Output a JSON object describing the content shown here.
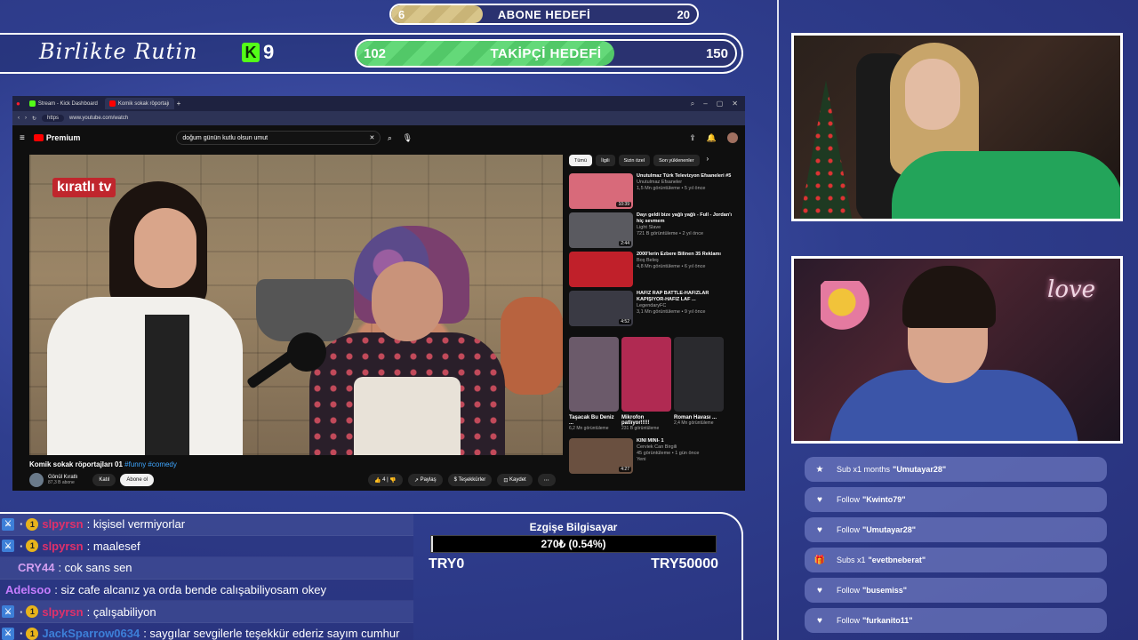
{
  "sub_goal": {
    "min": "6",
    "title": "ABONE HEDEFİ",
    "max": "20",
    "progress": 0.3
  },
  "follow_goal": {
    "min": "102",
    "title": "TAKİPÇİ HEDEFİ",
    "max": "150",
    "progress": 0.68
  },
  "stream": {
    "title": "Birlikte Rutin",
    "kick_badge": "K",
    "viewer_count": "9"
  },
  "browser": {
    "tabs": [
      {
        "label": "Stream - Kick Dashboard",
        "color": "#53fc18"
      },
      {
        "label": "Komik sokak röportajı",
        "color": "#ff0000"
      }
    ],
    "url": "www.youtube.com/watch",
    "https_tag": "https"
  },
  "youtube": {
    "logo": "Premium",
    "search_query": "doğum günün kutlu olsun umut",
    "brand_overlay": "kıratlı tv",
    "video_title": "Komik sokak röportajları 01",
    "video_tags": "#funny #comedy",
    "channel_name": "Gönül Kıratlı",
    "channel_subs": "87,3 B abone",
    "join_label": "Katıl",
    "subscribe_label": "Abone ol",
    "like_count": "4",
    "share_label": "Paylaş",
    "thanks_label": "Teşekkürler",
    "save_label": "Kaydet",
    "chips": [
      "Tümü",
      "İlgili",
      "Sizin özel",
      "Son yüklenenler"
    ],
    "recommendations": [
      {
        "title": "Unutulmaz Türk Televizyon Efsaneleri #5",
        "channel": "Unutulmaz Efsaneler",
        "meta": "1,5 Mn görüntüleme • 5 yıl önce",
        "duration": "10:39",
        "color": "#d86a7a"
      },
      {
        "title": "Dayı geldi bize yağlı yağlı - Full - Jordan'ı hiç sevmem",
        "channel": "Light Slave",
        "meta": "721 B görüntüleme • 2 yıl önce",
        "duration": "2:44",
        "color": "#5a5a60"
      },
      {
        "title": "2000'lerin Ezbere Bilinen 35 Reklamı",
        "channel": "Boş Beleş",
        "meta": "4,8 Mn görüntüleme • 6 yıl önce",
        "duration": "",
        "color": "#c0202a"
      },
      {
        "title": "HAFIZ RAP BATTLE-HAFIZLAR KAPIŞIYOR-HAFIZ LAF ...",
        "channel": "LegendaryFC",
        "meta": "3,1 Mn görüntüleme • 9 yıl önce",
        "duration": "4:52",
        "color": "#3a3a44"
      }
    ],
    "shorts": [
      {
        "title": "Taşacak Bu Deniz ...",
        "meta": "6,2 Mn görüntüleme",
        "color": "#6b5a6a"
      },
      {
        "title": "Mikrofon patlıyor!!!!!",
        "meta": "231 B görüntüleme",
        "color": "#b02a52"
      },
      {
        "title": "Roman Havası ...",
        "meta": "2,4 Mn görüntüleme",
        "color": "#2a2a2e"
      }
    ],
    "last_rec": {
      "title": "KINI MINI- 1",
      "channel": "Cerviek Can Birgili",
      "meta": "45 görüntüleme • 1 gün önce",
      "badge": "Yeni",
      "duration": "4:27",
      "color": "#6a5040"
    }
  },
  "events": [
    {
      "icon": "★",
      "icon_name": "star-icon",
      "text": "Sub x1 months",
      "user": "\"Umutayar28\""
    },
    {
      "icon": "♥",
      "icon_name": "heart-icon",
      "text": "Follow",
      "user": "\"Kwinto79\""
    },
    {
      "icon": "♥",
      "icon_name": "heart-icon",
      "text": "Follow",
      "user": "\"Umutayar28\""
    },
    {
      "icon": "🎁",
      "icon_name": "gift-icon",
      "text": "Subs x1",
      "user": "\"evetbneberat\""
    },
    {
      "icon": "♥",
      "icon_name": "heart-icon",
      "text": "Follow",
      "user": "\"busemiss\""
    },
    {
      "icon": "♥",
      "icon_name": "heart-icon",
      "text": "Follow",
      "user": "\"furkanito11\""
    }
  ],
  "chat": [
    {
      "badges": true,
      "user": "slpyrsn",
      "user_color": "#e0306a",
      "message": ": kişisel vermiyorlar"
    },
    {
      "badges": true,
      "user": "slpyrsn",
      "user_color": "#e0306a",
      "message": ": maalesef"
    },
    {
      "badges": false,
      "user": "CRY44",
      "user_color": "#d29ef0",
      "message": ": cok sans sen"
    },
    {
      "badges": false,
      "user": "Adelsoo",
      "user_color": "#c77dff",
      "message": ": siz cafe alcanız ya orda bende calışabiliyosam okey"
    },
    {
      "badges": true,
      "user": "slpyrsn",
      "user_color": "#e0306a",
      "message": ": çalışabiliyon"
    },
    {
      "badges": true,
      "user": "JackSparrow0634",
      "user_color": "#3d7fd8",
      "message": ": saygılar sevgilerle teşekkür ederiz sayım cumhur"
    }
  ],
  "donation": {
    "name": "Ezgişe Bilgisayar",
    "current": "270₺ (0.54%)",
    "progress": 0.0054,
    "min": "TRY0",
    "max": "TRY50000"
  }
}
